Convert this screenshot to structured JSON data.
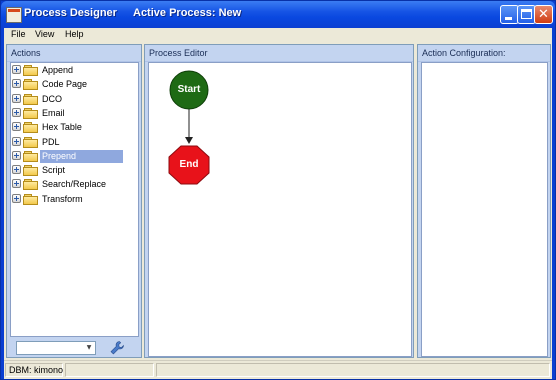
{
  "window": {
    "app_title": "Process Designer",
    "active_process": "Active Process: New",
    "colors": {
      "titlebar": "#0b48e0",
      "panel_header": "#c3d4f0",
      "selection": "#8fa8de"
    }
  },
  "menu": {
    "file": "File",
    "view": "View",
    "help": "Help"
  },
  "panels": {
    "actions": {
      "title": "Actions",
      "items": [
        {
          "label": "Append"
        },
        {
          "label": "Code Page"
        },
        {
          "label": "DCO"
        },
        {
          "label": "Email"
        },
        {
          "label": "Hex Table"
        },
        {
          "label": "PDL"
        },
        {
          "label": "Prepend",
          "selected": true
        },
        {
          "label": "Script"
        },
        {
          "label": "Search/Replace"
        },
        {
          "label": "Transform"
        }
      ],
      "filter_combo": {
        "value": ""
      },
      "tool_icon": "wrench-icon"
    },
    "editor": {
      "title": "Process Editor",
      "nodes": {
        "start": "Start",
        "end": "End"
      },
      "colors": {
        "start": "#1e6a14",
        "end": "#e8121a"
      }
    },
    "config": {
      "title": "Action Configuration:"
    }
  },
  "status": {
    "dbm": "DBM: kimono",
    "cell2": "",
    "cell3": ""
  }
}
